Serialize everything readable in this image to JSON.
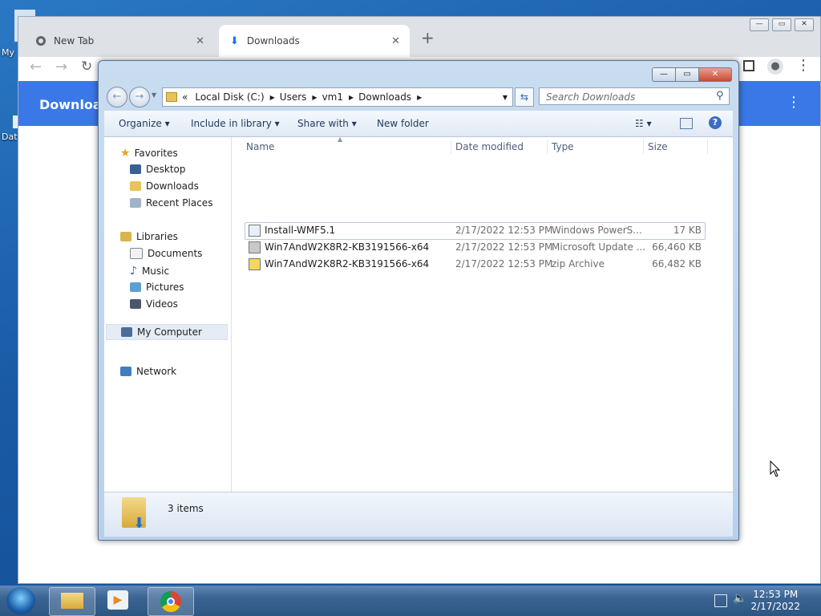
{
  "desktop": {
    "icon1_label": "My",
    "icon2_label": "Dat"
  },
  "chrome": {
    "tabs": [
      {
        "title": "New Tab",
        "icon": "chrome-icon"
      },
      {
        "title": "Downloads",
        "icon": "download-icon"
      }
    ],
    "new_tab": "+",
    "close_glyph": "✕",
    "page_title": "Download",
    "menu_glyph": "⋮"
  },
  "explorer": {
    "controls": {
      "minimize": "—",
      "maximize": "▭",
      "close": "✕"
    },
    "breadcrumb": [
      "«",
      "Local Disk (C:)",
      "Users",
      "vm1",
      "Downloads"
    ],
    "search_placeholder": "Search Downloads",
    "toolbar": {
      "organize": "Organize ▾",
      "include": "Include in library ▾",
      "share": "Share with ▾",
      "new_folder": "New folder"
    },
    "nav": {
      "favorites": "Favorites",
      "desktop": "Desktop",
      "downloads": "Downloads",
      "recent": "Recent Places",
      "libraries": "Libraries",
      "documents": "Documents",
      "music": "Music",
      "pictures": "Pictures",
      "videos": "Videos",
      "computer": "My Computer",
      "network": "Network"
    },
    "columns": {
      "name": "Name",
      "date": "Date modified",
      "type": "Type",
      "size": "Size"
    },
    "files": [
      {
        "name": "Install-WMF5.1",
        "date": "2/17/2022 12:53 PM",
        "type": "Windows PowerS...",
        "size": "17 KB"
      },
      {
        "name": "Win7AndW2K8R2-KB3191566-x64",
        "date": "2/17/2022 12:53 PM",
        "type": "Microsoft Update ...",
        "size": "66,460 KB"
      },
      {
        "name": "Win7AndW2K8R2-KB3191566-x64",
        "date": "2/17/2022 12:53 PM",
        "type": "zip Archive",
        "size": "66,482 KB"
      }
    ],
    "status": "3 items"
  },
  "taskbar": {
    "time": "12:53 PM",
    "date": "2/17/2022"
  }
}
